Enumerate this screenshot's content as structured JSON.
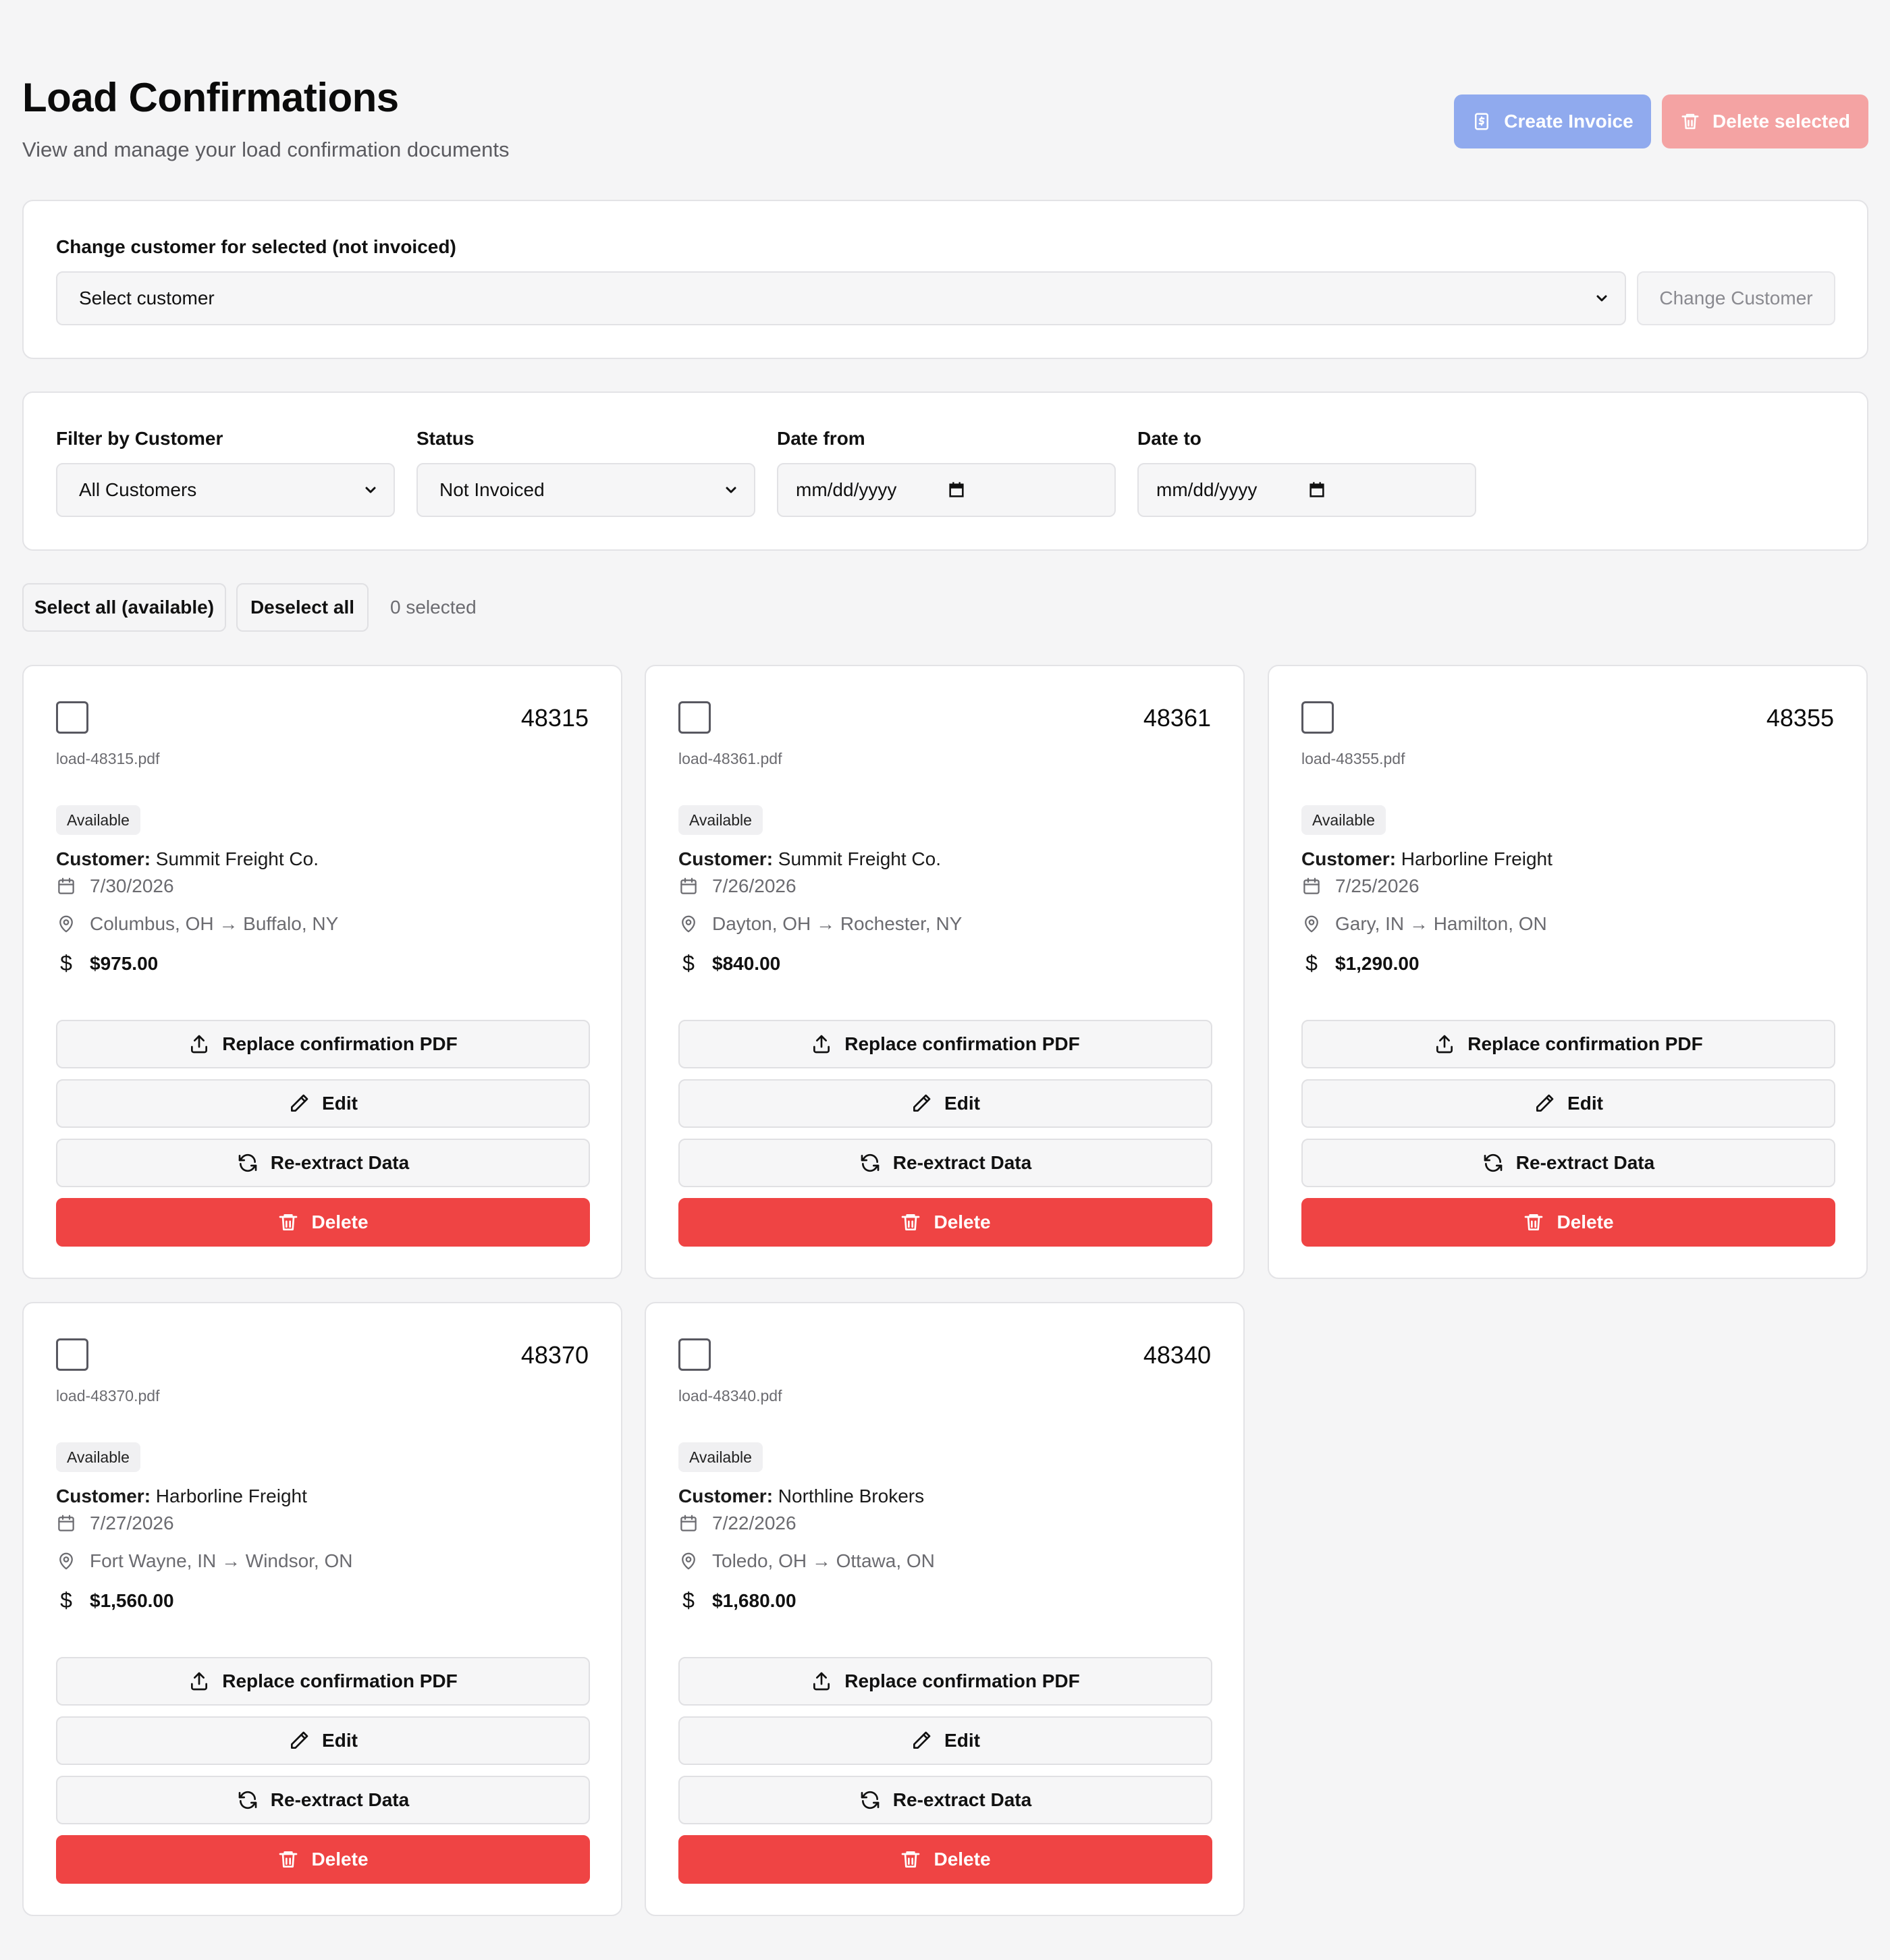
{
  "header": {
    "title": "Load Confirmations",
    "subtitle": "View and manage your load confirmation documents",
    "create_invoice_label": "Create Invoice",
    "delete_selected_label": "Delete selected"
  },
  "change_customer": {
    "label": "Change customer for selected (not invoiced)",
    "select_value": "Select customer",
    "button_label": "Change Customer"
  },
  "filters": {
    "customer_label": "Filter by Customer",
    "customer_value": "All Customers",
    "status_label": "Status",
    "status_value": "Not Invoiced",
    "date_from_label": "Date from",
    "date_from_placeholder": "mm/dd/yyyy",
    "date_to_label": "Date to",
    "date_to_placeholder": "mm/dd/yyyy"
  },
  "selection": {
    "select_all_label": "Select all (available)",
    "deselect_all_label": "Deselect all",
    "count_text": "0 selected"
  },
  "card_labels": {
    "customer_prefix": "Customer:",
    "replace_label": "Replace confirmation PDF",
    "edit_label": "Edit",
    "reextract_label": "Re-extract Data",
    "delete_label": "Delete"
  },
  "loads": [
    {
      "number": "48315",
      "file": "load-48315.pdf",
      "status": "Available",
      "customer": "Summit Freight Co.",
      "date": "7/30/2026",
      "route": "Columbus, OH → Buffalo, NY",
      "amount": "$975.00"
    },
    {
      "number": "48361",
      "file": "load-48361.pdf",
      "status": "Available",
      "customer": "Summit Freight Co.",
      "date": "7/26/2026",
      "route": "Dayton, OH → Rochester, NY",
      "amount": "$840.00"
    },
    {
      "number": "48355",
      "file": "load-48355.pdf",
      "status": "Available",
      "customer": "Harborline Freight",
      "date": "7/25/2026",
      "route": "Gary, IN → Hamilton, ON",
      "amount": "$1,290.00"
    },
    {
      "number": "48370",
      "file": "load-48370.pdf",
      "status": "Available",
      "customer": "Harborline Freight",
      "date": "7/27/2026",
      "route": "Fort Wayne, IN → Windsor, ON",
      "amount": "$1,560.00"
    },
    {
      "number": "48340",
      "file": "load-48340.pdf",
      "status": "Available",
      "customer": "Northline Brokers",
      "date": "7/22/2026",
      "route": "Toledo, OH → Ottawa, ON",
      "amount": "$1,680.00"
    }
  ],
  "colors": {
    "primary_disabled": "#90aaee",
    "danger": "#ef4444",
    "danger_disabled": "#f4a3a3",
    "background": "#f5f5f6"
  }
}
